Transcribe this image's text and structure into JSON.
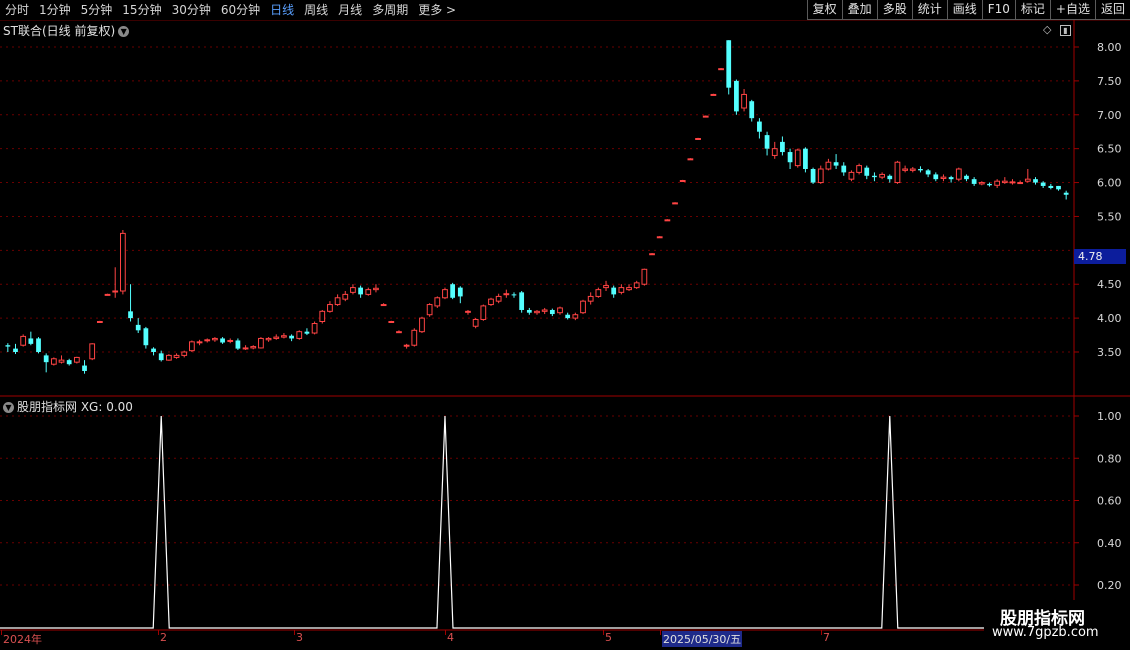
{
  "toolbar": {
    "periods": [
      "分时",
      "1分钟",
      "5分钟",
      "15分钟",
      "30分钟",
      "60分钟",
      "日线",
      "周线",
      "月线",
      "多周期",
      "更多 >"
    ],
    "active_period": "日线",
    "tools": [
      "复权",
      "叠加",
      "多股",
      "统计",
      "画线",
      "F10",
      "标记",
      "+自选",
      "返回"
    ]
  },
  "main_panel": {
    "title": "ST联合(日线 前复权)",
    "price_tag": "4.78",
    "y_ticks": [
      "8.00",
      "7.50",
      "7.00",
      "6.50",
      "6.00",
      "5.50",
      "4.50",
      "4.00",
      "3.50"
    ]
  },
  "sub_panel": {
    "title": "股朋指标网 XG: 0.00",
    "y_ticks": [
      "1.00",
      "0.80",
      "0.60",
      "0.40",
      "0.20"
    ]
  },
  "x_axis": {
    "labels": [
      "2024年",
      "2",
      "3",
      "4",
      "5",
      "2025/05/30/五",
      "7"
    ],
    "selected": "2025/05/30/五"
  },
  "watermark": {
    "name": "股朋指标网",
    "url": "www.7gpzb.com"
  },
  "colors": {
    "up": "#ff4444",
    "down": "#54ffff",
    "grid": "#6a0000",
    "axis": "#a00000",
    "signal": "#ffffff"
  },
  "chart_data": [
    {
      "type": "candlestick",
      "title": "ST联合(日线 前复权)",
      "ylim": [
        3.0,
        8.2
      ],
      "candles": [
        [
          3.6,
          3.58,
          3.63,
          3.5
        ],
        [
          3.55,
          3.5,
          3.62,
          3.47
        ],
        [
          3.6,
          3.73,
          3.76,
          3.58
        ],
        [
          3.7,
          3.62,
          3.8,
          3.6
        ],
        [
          3.7,
          3.5,
          3.72,
          3.48
        ],
        [
          3.45,
          3.35,
          3.48,
          3.2
        ],
        [
          3.32,
          3.4,
          3.42,
          3.3
        ],
        [
          3.35,
          3.38,
          3.45,
          3.33
        ],
        [
          3.38,
          3.32,
          3.4,
          3.3
        ],
        [
          3.35,
          3.42,
          3.43,
          3.33
        ],
        [
          3.3,
          3.22,
          3.38,
          3.18
        ],
        [
          3.4,
          3.62,
          3.63,
          3.38
        ],
        [
          3.95,
          3.95,
          3.96,
          3.94
        ],
        [
          4.35,
          4.35,
          4.36,
          4.34
        ],
        [
          4.4,
          4.4,
          4.75,
          4.3
        ],
        [
          4.4,
          5.25,
          5.3,
          4.35
        ],
        [
          4.1,
          4.0,
          4.5,
          3.95
        ],
        [
          3.9,
          3.82,
          4.0,
          3.78
        ],
        [
          3.85,
          3.6,
          3.87,
          3.55
        ],
        [
          3.55,
          3.5,
          3.57,
          3.45
        ],
        [
          3.48,
          3.38,
          3.52,
          3.36
        ],
        [
          3.38,
          3.45,
          3.47,
          3.37
        ],
        [
          3.42,
          3.45,
          3.48,
          3.4
        ],
        [
          3.45,
          3.5,
          3.52,
          3.42
        ],
        [
          3.52,
          3.65,
          3.67,
          3.5
        ],
        [
          3.64,
          3.65,
          3.68,
          3.6
        ],
        [
          3.67,
          3.68,
          3.7,
          3.64
        ],
        [
          3.68,
          3.7,
          3.72,
          3.65
        ],
        [
          3.7,
          3.64,
          3.72,
          3.62
        ],
        [
          3.66,
          3.67,
          3.7,
          3.63
        ],
        [
          3.67,
          3.55,
          3.7,
          3.53
        ],
        [
          3.55,
          3.56,
          3.6,
          3.53
        ],
        [
          3.56,
          3.58,
          3.6,
          3.54
        ],
        [
          3.56,
          3.7,
          3.72,
          3.55
        ],
        [
          3.68,
          3.7,
          3.72,
          3.65
        ],
        [
          3.7,
          3.72,
          3.76,
          3.68
        ],
        [
          3.72,
          3.74,
          3.78,
          3.7
        ],
        [
          3.74,
          3.7,
          3.76,
          3.66
        ],
        [
          3.7,
          3.8,
          3.82,
          3.68
        ],
        [
          3.8,
          3.77,
          3.85,
          3.75
        ],
        [
          3.78,
          3.92,
          3.95,
          3.76
        ],
        [
          3.95,
          4.1,
          4.12,
          3.92
        ],
        [
          4.1,
          4.2,
          4.25,
          4.08
        ],
        [
          4.2,
          4.3,
          4.35,
          4.18
        ],
        [
          4.28,
          4.35,
          4.4,
          4.25
        ],
        [
          4.38,
          4.45,
          4.5,
          4.35
        ],
        [
          4.45,
          4.35,
          4.48,
          4.3
        ],
        [
          4.35,
          4.42,
          4.45,
          4.33
        ],
        [
          4.42,
          4.44,
          4.5,
          4.38
        ],
        [
          4.2,
          4.2,
          4.22,
          4.18
        ],
        [
          3.95,
          3.95,
          3.96,
          3.94
        ],
        [
          3.8,
          3.8,
          3.82,
          3.78
        ],
        [
          3.6,
          3.6,
          3.62,
          3.55
        ],
        [
          3.6,
          3.82,
          3.85,
          3.58
        ],
        [
          3.8,
          4.0,
          4.02,
          3.78
        ],
        [
          4.05,
          4.2,
          4.22,
          4.02
        ],
        [
          4.18,
          4.3,
          4.32,
          4.15
        ],
        [
          4.3,
          4.42,
          4.45,
          4.28
        ],
        [
          4.5,
          4.3,
          4.52,
          4.28
        ],
        [
          4.45,
          4.32,
          4.47,
          4.22
        ],
        [
          4.1,
          4.1,
          4.12,
          4.05
        ],
        [
          3.88,
          3.98,
          4.0,
          3.85
        ],
        [
          3.98,
          4.18,
          4.2,
          3.96
        ],
        [
          4.2,
          4.28,
          4.3,
          4.18
        ],
        [
          4.25,
          4.32,
          4.36,
          4.22
        ],
        [
          4.35,
          4.36,
          4.42,
          4.3
        ],
        [
          4.35,
          4.34,
          4.38,
          4.3
        ],
        [
          4.38,
          4.12,
          4.4,
          4.08
        ],
        [
          4.12,
          4.08,
          4.15,
          4.05
        ],
        [
          4.08,
          4.1,
          4.12,
          4.05
        ],
        [
          4.1,
          4.12,
          4.15,
          4.06
        ],
        [
          4.12,
          4.06,
          4.14,
          4.03
        ],
        [
          4.08,
          4.15,
          4.17,
          4.05
        ],
        [
          4.05,
          4.0,
          4.08,
          3.98
        ],
        [
          4.0,
          4.05,
          4.08,
          3.97
        ],
        [
          4.08,
          4.25,
          4.27,
          4.06
        ],
        [
          4.25,
          4.32,
          4.38,
          4.2
        ],
        [
          4.32,
          4.42,
          4.45,
          4.3
        ],
        [
          4.45,
          4.48,
          4.55,
          4.4
        ],
        [
          4.45,
          4.35,
          4.48,
          4.3
        ],
        [
          4.38,
          4.45,
          4.5,
          4.35
        ],
        [
          4.42,
          4.45,
          4.5,
          4.4
        ],
        [
          4.45,
          4.52,
          4.55,
          4.43
        ],
        [
          4.5,
          4.72,
          4.73,
          4.48
        ],
        [
          4.95,
          4.95,
          4.96,
          4.94
        ],
        [
          5.2,
          5.2,
          5.21,
          5.19
        ],
        [
          5.45,
          5.45,
          5.46,
          5.44
        ],
        [
          5.7,
          5.7,
          5.71,
          5.69
        ],
        [
          6.03,
          6.03,
          6.04,
          6.02
        ],
        [
          6.35,
          6.35,
          6.36,
          6.34
        ],
        [
          6.65,
          6.65,
          6.66,
          6.64
        ],
        [
          6.98,
          6.98,
          6.99,
          6.97
        ],
        [
          7.3,
          7.3,
          7.31,
          7.29
        ],
        [
          7.68,
          7.68,
          7.69,
          7.67
        ],
        [
          8.1,
          7.4,
          8.1,
          7.3
        ],
        [
          7.5,
          7.05,
          7.52,
          7.0
        ],
        [
          7.1,
          7.3,
          7.38,
          7.05
        ],
        [
          7.2,
          6.95,
          7.22,
          6.9
        ],
        [
          6.9,
          6.75,
          6.95,
          6.65
        ],
        [
          6.7,
          6.5,
          6.75,
          6.4
        ],
        [
          6.4,
          6.5,
          6.6,
          6.35
        ],
        [
          6.6,
          6.45,
          6.68,
          6.4
        ],
        [
          6.45,
          6.3,
          6.5,
          6.2
        ],
        [
          6.25,
          6.48,
          6.5,
          6.22
        ],
        [
          6.5,
          6.2,
          6.52,
          6.15
        ],
        [
          6.2,
          6.0,
          6.22,
          5.98
        ],
        [
          6.0,
          6.2,
          6.25,
          5.98
        ],
        [
          6.2,
          6.3,
          6.35,
          6.18
        ],
        [
          6.3,
          6.25,
          6.42,
          6.2
        ],
        [
          6.25,
          6.15,
          6.3,
          6.1
        ],
        [
          6.05,
          6.15,
          6.18,
          6.02
        ],
        [
          6.15,
          6.25,
          6.28,
          6.12
        ],
        [
          6.22,
          6.1,
          6.25,
          6.05
        ],
        [
          6.1,
          6.08,
          6.15,
          6.02
        ],
        [
          6.08,
          6.12,
          6.15,
          6.05
        ],
        [
          6.1,
          6.05,
          6.12,
          6.0
        ],
        [
          6.0,
          6.3,
          6.32,
          5.98
        ],
        [
          6.18,
          6.2,
          6.25,
          6.15
        ],
        [
          6.18,
          6.2,
          6.23,
          6.15
        ],
        [
          6.2,
          6.18,
          6.24,
          6.15
        ],
        [
          6.18,
          6.12,
          6.2,
          6.08
        ],
        [
          6.12,
          6.05,
          6.15,
          6.02
        ],
        [
          6.06,
          6.08,
          6.12,
          6.02
        ],
        [
          6.08,
          6.05,
          6.1,
          6.0
        ],
        [
          6.05,
          6.2,
          6.22,
          6.02
        ],
        [
          6.1,
          6.05,
          6.12,
          6.02
        ],
        [
          6.05,
          5.98,
          6.08,
          5.95
        ],
        [
          5.98,
          6.0,
          6.02,
          5.96
        ],
        [
          5.98,
          5.96,
          6.0,
          5.94
        ],
        [
          5.96,
          6.02,
          6.05,
          5.92
        ],
        [
          6.0,
          6.02,
          6.08,
          5.98
        ],
        [
          6.0,
          6.01,
          6.05,
          5.97
        ],
        [
          6.0,
          6.0,
          6.03,
          5.98
        ],
        [
          6.02,
          6.05,
          6.2,
          6.0
        ],
        [
          6.05,
          6.0,
          6.08,
          5.97
        ],
        [
          6.0,
          5.95,
          6.02,
          5.92
        ],
        [
          5.95,
          5.92,
          5.98,
          5.9
        ],
        [
          5.95,
          5.9,
          5.95,
          5.88
        ],
        [
          5.85,
          5.82,
          5.88,
          5.75
        ]
      ]
    },
    {
      "type": "line",
      "title": "股朋指标网 XG: 0.00",
      "series": [
        {
          "name": "XG",
          "spikes_at_index": [
            20,
            57,
            115
          ],
          "value_at_spike": 1.0,
          "baseline": 0.0
        }
      ],
      "ylim": [
        0,
        1.08
      ]
    }
  ]
}
